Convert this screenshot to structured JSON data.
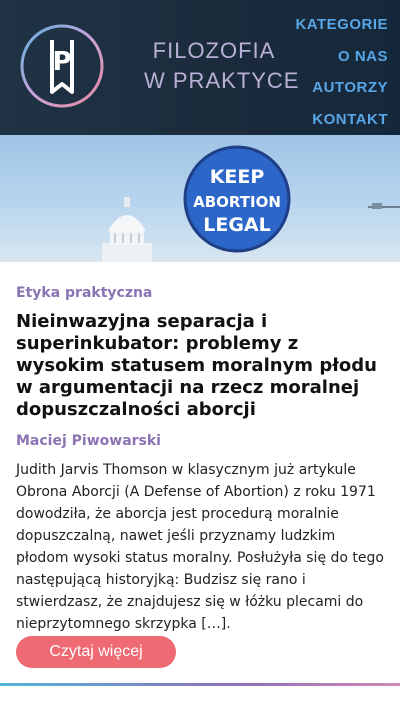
{
  "header": {
    "brand_line1": "FILOZOFIA",
    "brand_line2": "W PRAKTYCE",
    "logo_letter": "P",
    "nav": [
      "KATEGORIE",
      "O NAS",
      "AUTORZY",
      "KONTAKT"
    ]
  },
  "hero": {
    "sign_line1": "KEEP",
    "sign_line2": "ABORTION",
    "sign_line3": "LEGAL"
  },
  "article": {
    "category": "Etyka praktyczna",
    "title": "Nieinwazyjna separacja i superinkubator: problemy z wysokim statusem moralnym płodu w argumentacji na rzecz moralnej dopuszczalności aborcji",
    "author": "Maciej Piwowarski",
    "excerpt": "Judith Jarvis Thomson w klasycznym już artykule Obrona Aborcji (A Defense of Abortion) z roku 1971 dowodziła, że aborcja jest procedurą moralnie dopuszczalną, nawet jeśli przyznamy ludzkim płodom wysoki status moralny. Posłużyła się do tego następującą historyjką: Budzisz się rano i stwierdzasz, że znajdujesz się w łóżku plecami do nieprzytomnego skrzypka […].",
    "read_more": "Czytaj więcej"
  },
  "colors": {
    "header_bg": "#1b2b3c",
    "nav": "#58a6e6",
    "accent_purple": "#8a74b4",
    "button": "#ef6a73"
  }
}
